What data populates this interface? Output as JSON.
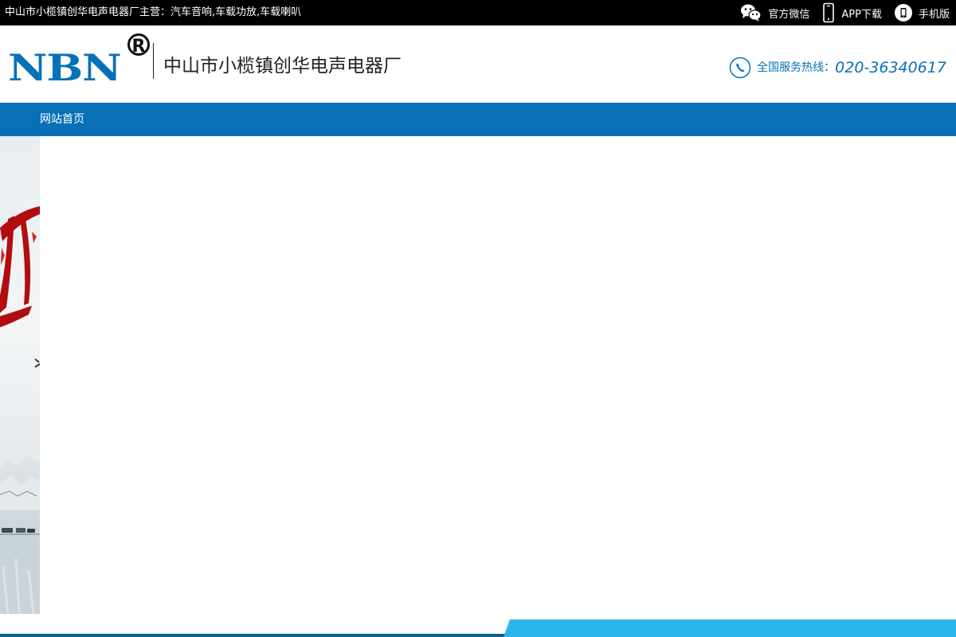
{
  "topbar": {
    "intro": "中山市小榄镇创华电声电器厂主营：汽车音响,车载功放,车载喇叭",
    "links": [
      {
        "label": "官方微信",
        "icon": "wechat-icon"
      },
      {
        "label": "APP下载",
        "icon": "smartphone-icon"
      },
      {
        "label": "手机版",
        "icon": "mobile-site-icon"
      }
    ]
  },
  "header": {
    "logo_text": "NBN",
    "logo_reg": "R",
    "company_name": "中山市小榄镇创华电声电器厂",
    "hotline_label": "全国服务热线：",
    "hotline_number": "020-36340617"
  },
  "nav": {
    "items": [
      {
        "label": "网站首页"
      }
    ]
  },
  "colors": {
    "topbar_bg": "#000000",
    "brand_blue": "#0771b8",
    "nav_bg": "#0770b6",
    "accent_cyan": "#2cb5ea",
    "banner_red": "#b10d10"
  }
}
